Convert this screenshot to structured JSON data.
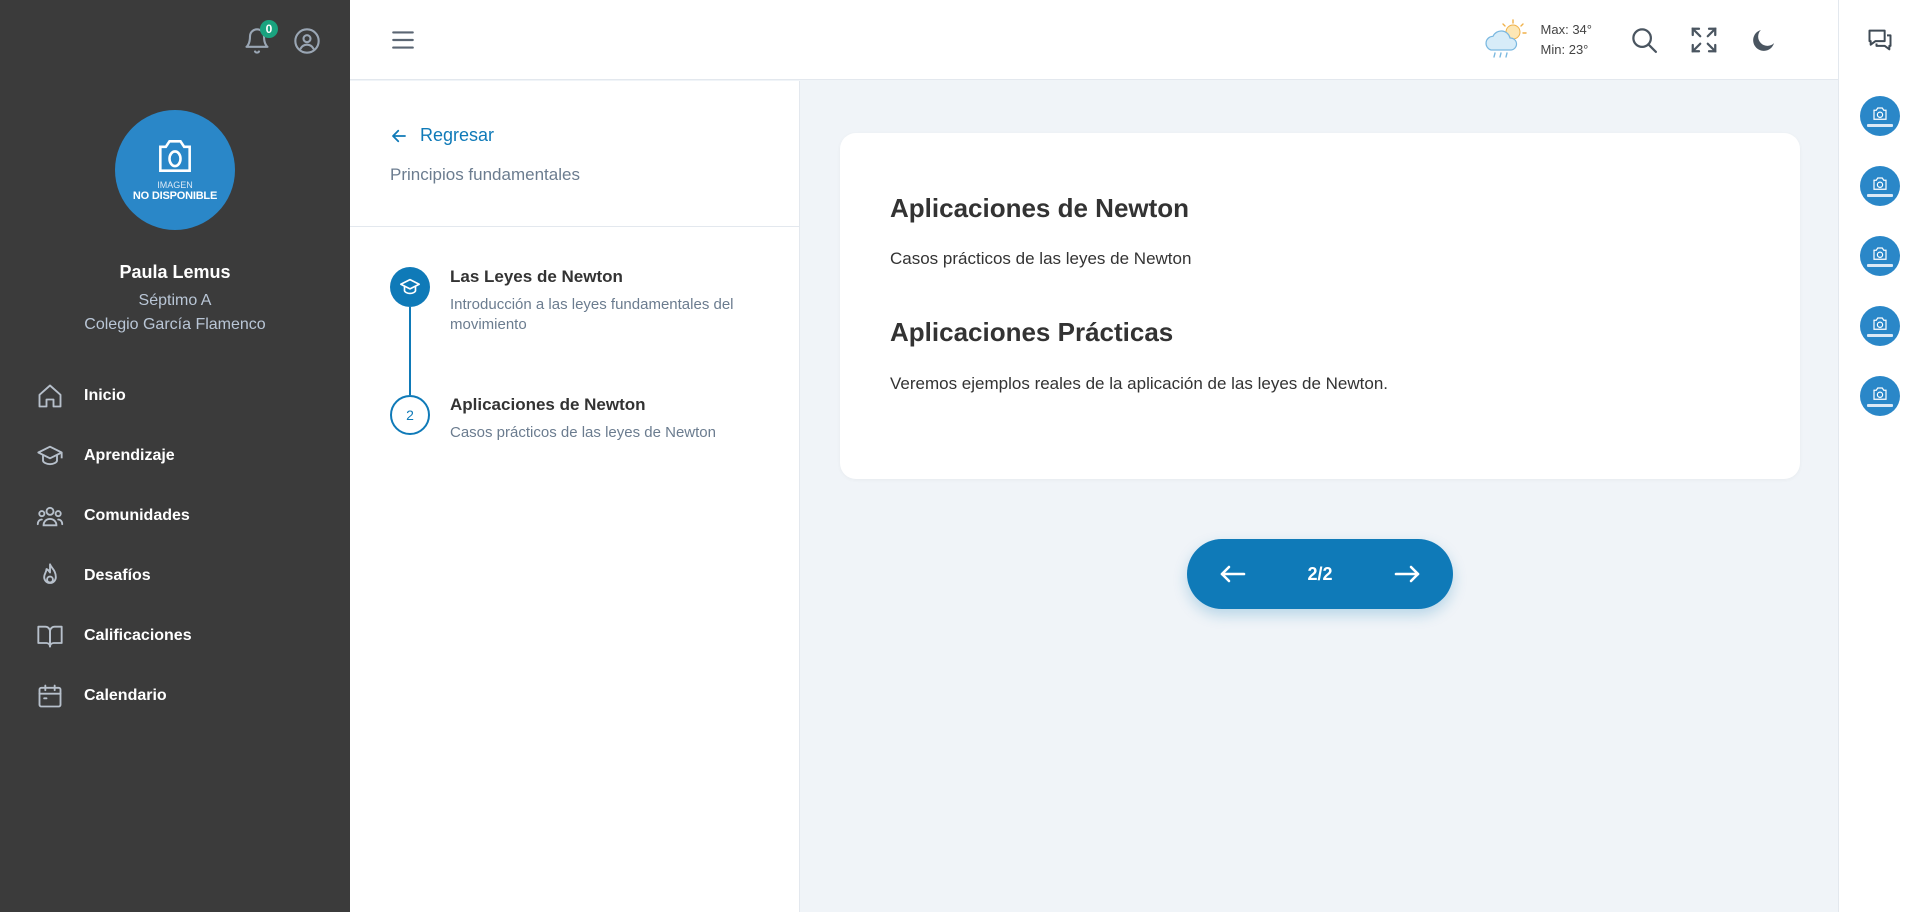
{
  "notifications": {
    "count": "0"
  },
  "user": {
    "avatar_line1": "IMAGEN",
    "avatar_line2": "NO DISPONIBLE",
    "name": "Paula Lemus",
    "grade": "Séptimo A",
    "school": "Colegio García Flamenco"
  },
  "nav": {
    "items": [
      {
        "label": "Inicio",
        "icon": "home-icon"
      },
      {
        "label": "Aprendizaje",
        "icon": "graduation-cap-icon"
      },
      {
        "label": "Comunidades",
        "icon": "users-icon"
      },
      {
        "label": "Desafíos",
        "icon": "flame-icon"
      },
      {
        "label": "Calificaciones",
        "icon": "book-open-icon"
      },
      {
        "label": "Calendario",
        "icon": "calendar-icon"
      }
    ]
  },
  "header": {
    "weather": {
      "icon": "cloud-sun-rain-icon",
      "max": "Max: 34°",
      "min": "Min: 23°"
    }
  },
  "lesson": {
    "back_label": "Regresar",
    "course_title": "Principios fundamentales",
    "steps": [
      {
        "title": "Las Leyes de Newton",
        "description": "Introducción a las leyes fundamentales del movimiento",
        "state": "done"
      },
      {
        "number": "2",
        "title": "Aplicaciones de Newton",
        "description": "Casos prácticos de las leyes de Newton",
        "state": "current"
      }
    ]
  },
  "content": {
    "title": "Aplicaciones de Newton",
    "subtitle": "Casos prácticos de las leyes de Newton",
    "section_title": "Aplicaciones Prácticas",
    "section_text": "Veremos ejemplos reales de la aplicación de las leyes de Newton."
  },
  "pager": {
    "current": "2",
    "separator": "/",
    "total": "2"
  },
  "colors": {
    "sidebar": "#3b3b3b",
    "accent": "#0f7ab8",
    "badge": "#1aa37f",
    "background": "#f0f4f8"
  }
}
